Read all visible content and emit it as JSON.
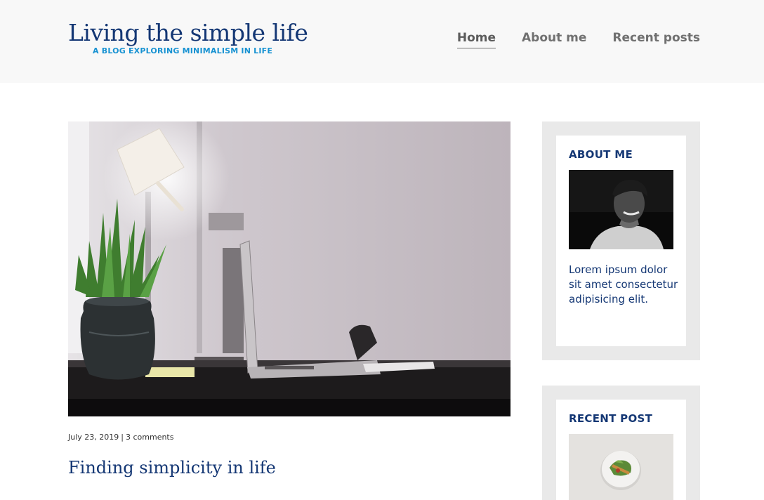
{
  "header": {
    "title": "Living the simple life",
    "tagline": "A BLOG EXPLORING MINIMALISM IN LIFE",
    "nav": [
      {
        "label": "Home",
        "active": true
      },
      {
        "label": "About me",
        "active": false
      },
      {
        "label": "Recent posts",
        "active": false
      }
    ]
  },
  "post": {
    "date": "July 23, 2019",
    "separator": "|",
    "comments": "3 comments",
    "title": "Finding simplicity in life"
  },
  "sidebar": {
    "about": {
      "title": "ABOUT ME",
      "text": "Lorem ipsum dolor sit amet consectetur adipisicing elit."
    },
    "recent": {
      "title": "RECENT POST"
    }
  },
  "colors": {
    "brand": "#143774",
    "accent": "#1792d2",
    "header_bg": "#f8f8f8",
    "widget_bg": "#e9e9e9"
  }
}
